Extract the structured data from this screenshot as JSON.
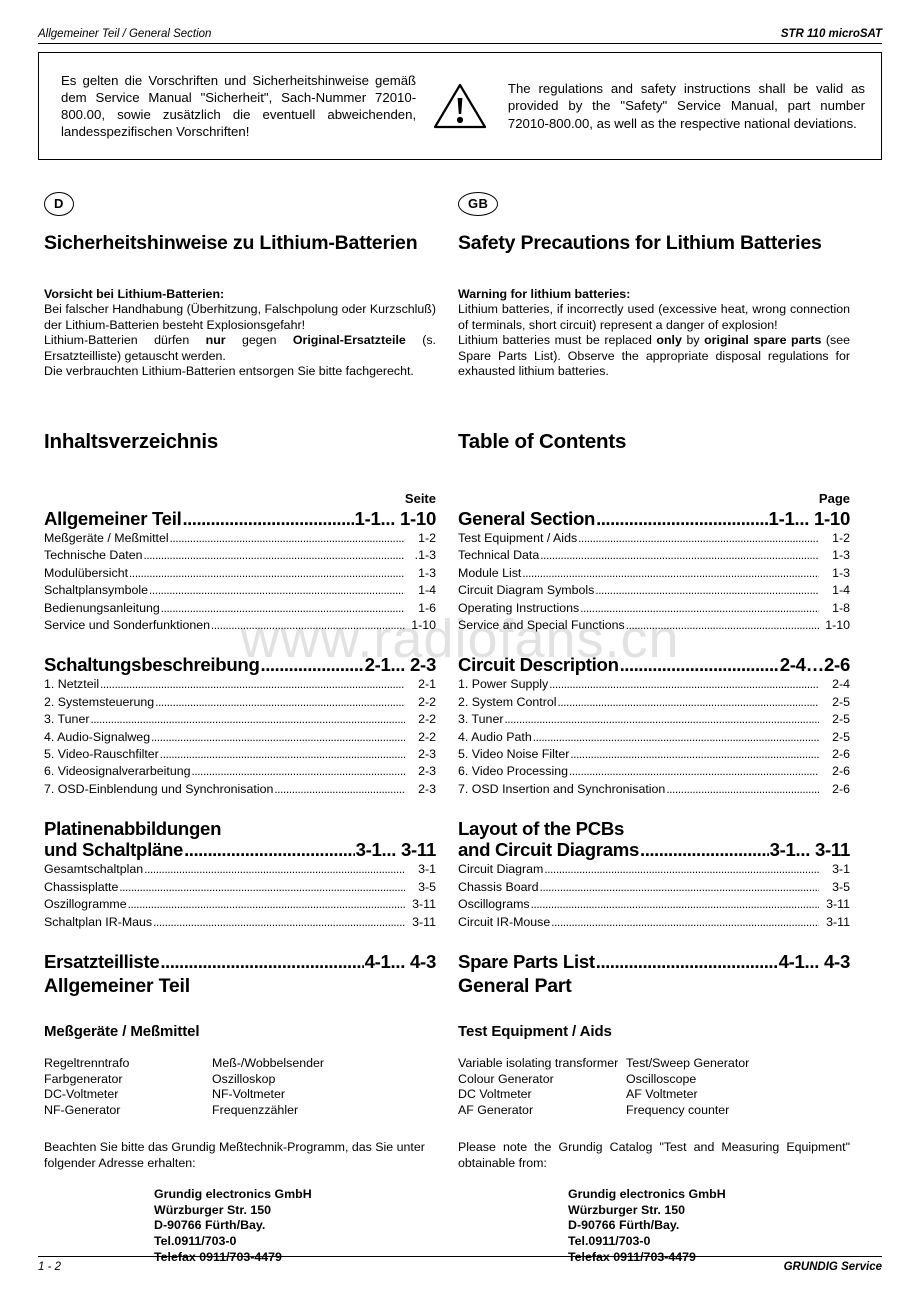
{
  "header": {
    "left": "Allgemeiner Teil / General Section",
    "right": "STR 110 microSAT"
  },
  "watermark": "www.radiofans.cn",
  "warning_box": {
    "icon": "warning-triangle-icon",
    "german": "Es gelten die Vorschriften und Sicherheitshinweise gemäß dem Service Manual \"Sicherheit\", Sach-Nummer 72010-800.00, sowie zusätzlich die eventuell abweichenden, landesspezifischen Vorschriften!",
    "english": "The regulations and safety instructions shall be valid as provided by the \"Safety\" Service Manual, part number 72010-800.00, as well as the respective national deviations."
  },
  "lithium": {
    "de": {
      "badge": "D",
      "title": "Sicherheitshinweise zu Lithium-Batterien",
      "subtitle": "Vorsicht bei Lithium-Batterien:",
      "p1": "Bei falscher Handhabung (Überhitzung, Falschpolung oder Kurzschluß) der Lithium-Batterien besteht Explosionsgefahr!",
      "p2_pre": "Lithium-Batterien dürfen ",
      "p2_b1": "nur",
      "p2_mid": " gegen ",
      "p2_b2": "Original-Ersatzteile",
      "p2_post": " (s. Ersatzteilliste) getauscht werden.",
      "p3": "Die verbrauchten Lithium-Batterien entsorgen Sie bitte fachgerecht."
    },
    "gb": {
      "badge": "GB",
      "title": "Safety Precautions for Lithium Batteries",
      "subtitle": "Warning for lithium batteries:",
      "p1": "Lithium batteries, if incorrectly used (excessive heat, wrong connection of terminals, short circuit) represent a danger of explosion!",
      "p2_pre": "Lithium batteries must be replaced ",
      "p2_b1": "only",
      "p2_mid": " by ",
      "p2_b2": "original spare parts",
      "p2_post": " (see Spare Parts List). Observe the appropriate disposal regulations for exhausted lithium batteries.",
      "p3": ""
    }
  },
  "toc_de": {
    "title": "Inhaltsverzeichnis",
    "page_head": "Seite",
    "sections": [
      {
        "major": {
          "label": "Allgemeiner Teil",
          "page": "1-1... 1-10"
        },
        "items": [
          {
            "label": "Meßgeräte / Meßmittel",
            "page": "1-2"
          },
          {
            "label": "Technische Daten",
            "page": ".1-3"
          },
          {
            "label": "Modulübersicht",
            "page": "1-3"
          },
          {
            "label": "Schaltplansymbole",
            "page": "1-4"
          },
          {
            "label": "Bedienungsanleitung",
            "page": "1-6"
          },
          {
            "label": "Service und Sonderfunktionen",
            "page": "1-10"
          }
        ]
      },
      {
        "major": {
          "label": "Schaltungsbeschreibung",
          "page": "2-1... 2-3"
        },
        "items": [
          {
            "label": "1. Netzteil",
            "page": "2-1"
          },
          {
            "label": "2. Systemsteuerung",
            "page": "2-2"
          },
          {
            "label": "3. Tuner",
            "page": "2-2"
          },
          {
            "label": "4. Audio-Signalweg",
            "page": "2-2"
          },
          {
            "label": "5. Video-Rauschfilter",
            "page": "2-3"
          },
          {
            "label": "6. Videosignalverarbeitung",
            "page": "2-3"
          },
          {
            "label": "7. OSD-Einblendung und Synchronisation",
            "page": "2-3"
          }
        ]
      },
      {
        "major_line1": "Platinenabbildungen",
        "major": {
          "label": "und Schaltpläne",
          "page": "3-1... 3-11"
        },
        "items": [
          {
            "label": "Gesamtschaltplan",
            "page": "3-1"
          },
          {
            "label": "Chassisplatte",
            "page": "3-5"
          },
          {
            "label": "Oszillogramme",
            "page": "3-11"
          },
          {
            "label": "Schaltplan IR-Maus",
            "page": "3-11"
          }
        ]
      },
      {
        "major": {
          "label": "Ersatzteilliste",
          "page": "4-1... 4-3"
        },
        "items": []
      }
    ]
  },
  "toc_gb": {
    "title": "Table of Contents",
    "page_head": "Page",
    "sections": [
      {
        "major": {
          "label": "General Section",
          "page": "1-1... 1-10"
        },
        "items": [
          {
            "label": "Test Equipment / Aids",
            "page": "1-2"
          },
          {
            "label": "Technical Data",
            "page": "1-3"
          },
          {
            "label": "Module List",
            "page": "1-3"
          },
          {
            "label": "Circuit Diagram Symbols",
            "page": "1-4"
          },
          {
            "label": "Operating Instructions",
            "page": "1-8"
          },
          {
            "label": "Service and Special Functions",
            "page": "1-10"
          }
        ]
      },
      {
        "major": {
          "label": "Circuit Description",
          "page": "2-4…2-6"
        },
        "items": [
          {
            "label": "1. Power Supply",
            "page": "2-4"
          },
          {
            "label": "2. System Control",
            "page": "2-5"
          },
          {
            "label": "3. Tuner",
            "page": "2-5"
          },
          {
            "label": "4. Audio Path",
            "page": "2-5"
          },
          {
            "label": "5. Video Noise Filter",
            "page": "2-6"
          },
          {
            "label": "6. Video Processing",
            "page": "2-6"
          },
          {
            "label": "7. OSD Insertion and Synchronisation",
            "page": "2-6"
          }
        ]
      },
      {
        "major_line1": "Layout of the PCBs",
        "major": {
          "label": "and Circuit Diagrams",
          "page": "3-1... 3-11"
        },
        "items": [
          {
            "label": "Circuit Diagram",
            "page": "3-1"
          },
          {
            "label": "Chassis Board",
            "page": "3-5"
          },
          {
            "label": "Oscillograms",
            "page": "3-11"
          },
          {
            "label": "Circuit IR-Mouse",
            "page": "3-11"
          }
        ]
      },
      {
        "major": {
          "label": "Spare Parts List",
          "page": "4-1... 4-3"
        },
        "items": []
      }
    ]
  },
  "general_de": {
    "part_title": "Allgemeiner Teil",
    "sub_title": "Meßgeräte / Meßmittel",
    "equipment": [
      {
        "c1": "Regeltrenntrafo",
        "c2": "Meß-/Wobbelsender"
      },
      {
        "c1": "Farbgenerator",
        "c2": "Oszilloskop"
      },
      {
        "c1": "DC-Voltmeter",
        "c2": "NF-Voltmeter"
      },
      {
        "c1": "NF-Generator",
        "c2": "Frequenzzähler"
      }
    ],
    "note": "Beachten Sie bitte das Grundig Meßtechnik-Programm, das Sie unter folgender Adresse erhalten:",
    "address": [
      "Grundig electronics GmbH",
      "Würzburger Str. 150",
      "D-90766 Fürth/Bay.",
      "Tel.0911/703-0",
      "Telefax 0911/703-4479"
    ]
  },
  "general_gb": {
    "part_title": "General Part",
    "sub_title": "Test Equipment / Aids",
    "equipment": [
      {
        "c1": "Variable isolating transformer",
        "c2": "Test/Sweep Generator"
      },
      {
        "c1": "Colour Generator",
        "c2": "Oscilloscope"
      },
      {
        "c1": "DC Voltmeter",
        "c2": "AF Voltmeter"
      },
      {
        "c1": "AF Generator",
        "c2": "Frequency counter"
      }
    ],
    "note": "Please note the Grundig Catalog \"Test and Measuring Equipment\" obtainable from:",
    "address": [
      "Grundig electronics GmbH",
      "Würzburger Str. 150",
      "D-90766 Fürth/Bay.",
      "Tel.0911/703-0",
      "Telefax 0911/703-4479"
    ]
  },
  "footer": {
    "left": "1 - 2",
    "right": "GRUNDIG Service"
  },
  "dots": "........................................................................................................................................................"
}
